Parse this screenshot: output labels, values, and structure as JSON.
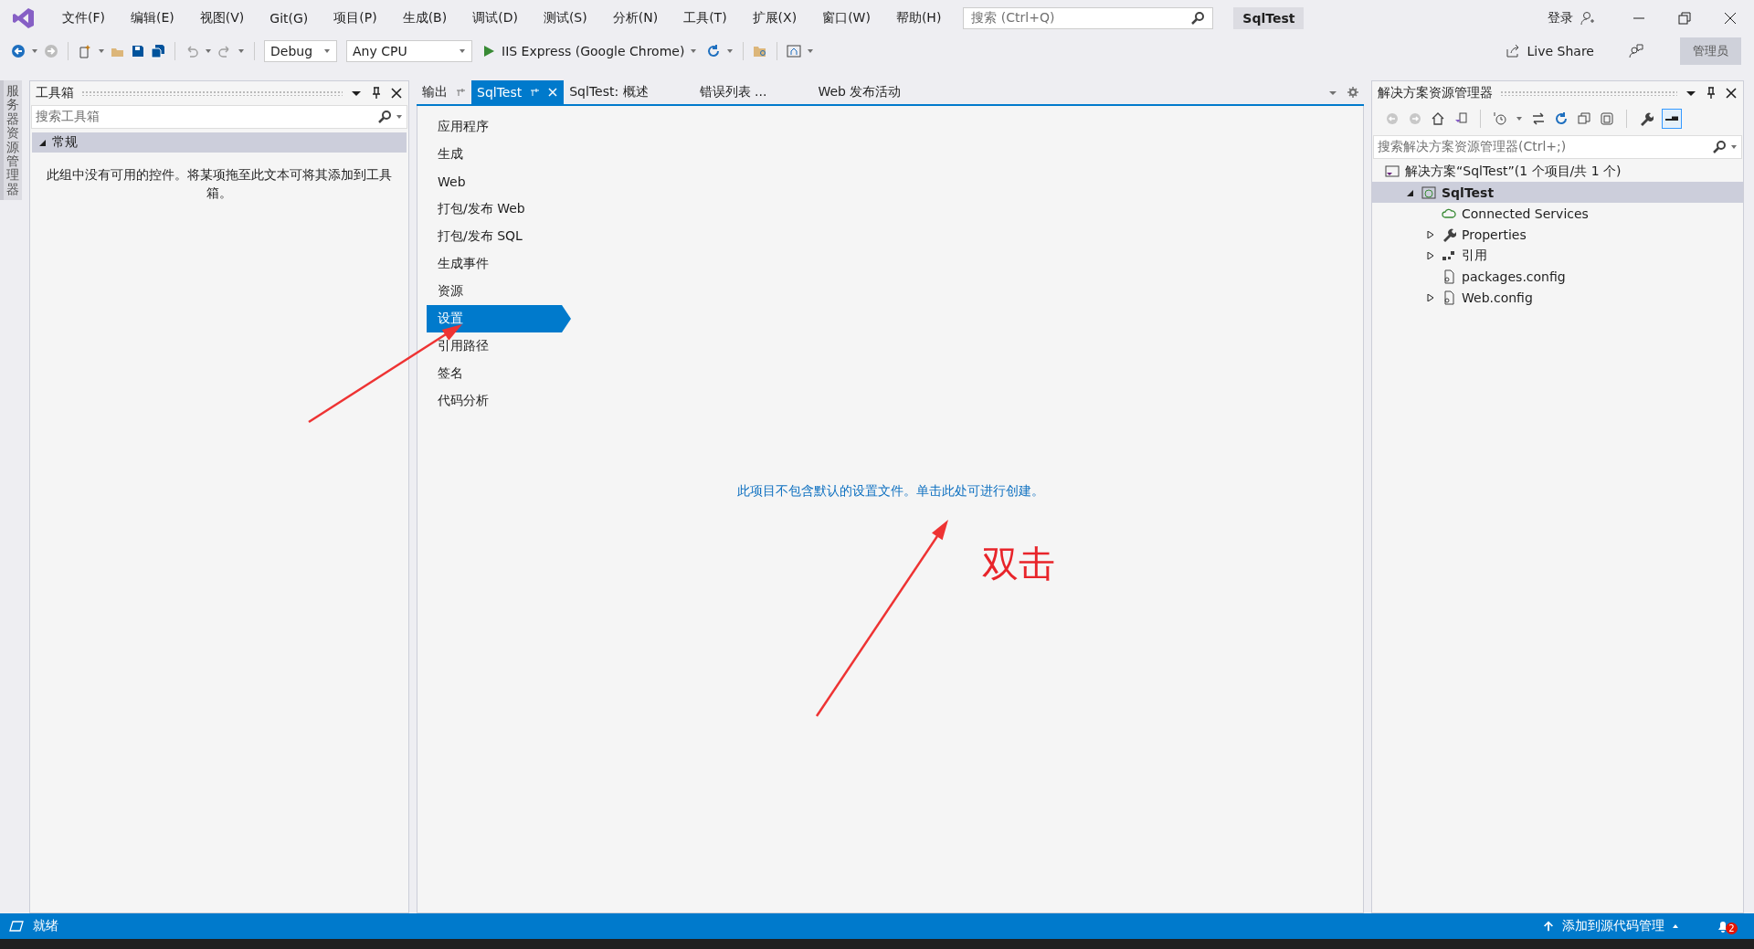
{
  "menu": [
    "文件(F)",
    "编辑(E)",
    "视图(V)",
    "Git(G)",
    "项目(P)",
    "生成(B)",
    "调试(D)",
    "测试(S)",
    "分析(N)",
    "工具(T)",
    "扩展(X)",
    "窗口(W)",
    "帮助(H)"
  ],
  "search": {
    "placeholder": "搜索 (Ctrl+Q)"
  },
  "solution_badge": "SqlTest",
  "login": "登录",
  "toolbar": {
    "configuration": "Debug",
    "platform": "Any CPU",
    "run_target": "IIS Express (Google Chrome)",
    "live_share": "Live Share",
    "admin": "管理员"
  },
  "side_tab": "服务器资源管理器",
  "toolbox": {
    "title": "工具箱",
    "search_placeholder": "搜索工具箱",
    "group": {
      "label": "常规",
      "expanded": true
    },
    "empty_message": "此组中没有可用的控件。将某项拖至此文本可将其添加到工具箱。"
  },
  "document_tabs": [
    {
      "label": "输出",
      "kind": "tool",
      "selected": false
    },
    {
      "label": "SqlTest",
      "kind": "document",
      "selected": true
    },
    {
      "label": "SqlTest: 概述",
      "kind": "plain",
      "selected": false
    },
    {
      "label": "错误列表 ...",
      "kind": "plain",
      "selected": false
    },
    {
      "label": "Web 发布活动",
      "kind": "plain",
      "selected": false
    }
  ],
  "project_nav": [
    {
      "label": "应用程序",
      "selected": false
    },
    {
      "label": "生成",
      "selected": false
    },
    {
      "label": "Web",
      "selected": false
    },
    {
      "label": "打包/发布 Web",
      "selected": false
    },
    {
      "label": "打包/发布 SQL",
      "selected": false
    },
    {
      "label": "生成事件",
      "selected": false
    },
    {
      "label": "资源",
      "selected": false
    },
    {
      "label": "设置",
      "selected": true
    },
    {
      "label": "引用路径",
      "selected": false
    },
    {
      "label": "签名",
      "selected": false
    },
    {
      "label": "代码分析",
      "selected": false
    }
  ],
  "settings_message": "此项目不包含默认的设置文件。单击此处可进行创建。",
  "annotation": "双击",
  "solution_explorer": {
    "title": "解决方案资源管理器",
    "search_placeholder": "搜索解决方案资源管理器(Ctrl+;)",
    "tree": [
      {
        "label": "解决方案“SqlTest”(1 个项目/共 1 个)",
        "kind": "solution",
        "selected": false,
        "children": [
          {
            "label": "SqlTest",
            "kind": "project",
            "selected": true,
            "expanded": true,
            "children": [
              {
                "label": "Connected Services",
                "kind": "cloud",
                "selected": false
              },
              {
                "label": "Properties",
                "kind": "wrench",
                "selected": false,
                "expanded": false
              },
              {
                "label": "引用",
                "kind": "references",
                "selected": false,
                "expanded": false
              },
              {
                "label": "packages.config",
                "kind": "config",
                "selected": false
              },
              {
                "label": "Web.config",
                "kind": "config",
                "selected": false,
                "expanded": false
              }
            ]
          }
        ]
      }
    ]
  },
  "status_bar": {
    "state": "就绪",
    "source_control": "添加到源代码管理",
    "notifications": "2"
  }
}
